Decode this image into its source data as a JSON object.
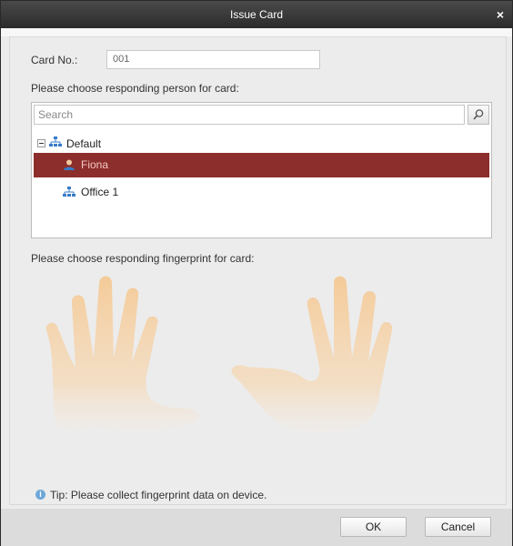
{
  "window": {
    "title": "Issue Card",
    "close_glyph": "×"
  },
  "card": {
    "label": "Card No.:",
    "value": "001"
  },
  "person_section": {
    "prompt": "Please choose responding person for card:"
  },
  "search": {
    "placeholder": "Search",
    "icon": "search-icon"
  },
  "tree": {
    "root": {
      "label": "Default",
      "icon": "org-icon",
      "expanded": true
    },
    "children": [
      {
        "label": "Fiona",
        "icon": "person-icon",
        "selected": true
      },
      {
        "label": "Office 1",
        "icon": "org-icon",
        "selected": false
      }
    ]
  },
  "fingerprint_section": {
    "prompt": "Please choose responding fingerprint for card:"
  },
  "tip": {
    "text": "Tip: Please collect fingerprint data on device."
  },
  "buttons": {
    "ok": "OK",
    "cancel": "Cancel"
  },
  "colors": {
    "selection": "#8c2e2b",
    "hand_fill": "#f6c58a",
    "titlebar": "#333333"
  }
}
